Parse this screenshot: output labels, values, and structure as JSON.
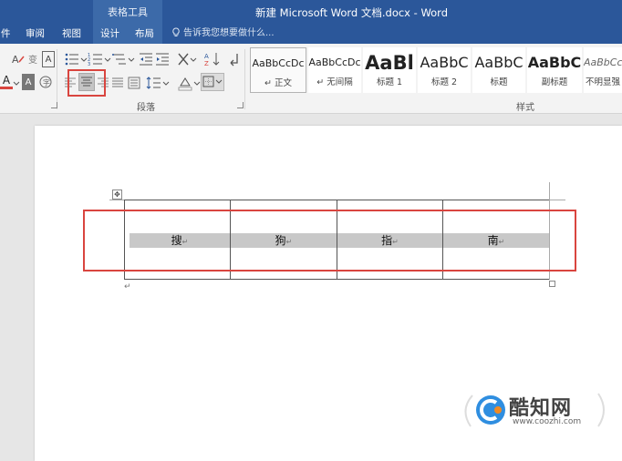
{
  "titlebar": {
    "context_tab": "表格工具",
    "doc_title": "新建 Microsoft Word 文档.docx - Word"
  },
  "tabs": [
    {
      "label": "件"
    },
    {
      "label": "审阅"
    },
    {
      "label": "视图"
    },
    {
      "label": "设计"
    },
    {
      "label": "布局"
    }
  ],
  "tell_me": "告诉我您想要做什么...",
  "ribbon": {
    "groups": {
      "paragraph": "段落",
      "styles": "样式"
    },
    "styles": [
      {
        "preview": "AaBbCcDc",
        "name": "正文"
      },
      {
        "preview": "AaBbCcDc",
        "name": "无间隔"
      },
      {
        "preview": "AaBl",
        "name": "标题 1"
      },
      {
        "preview": "AaBbC",
        "name": "标题 2"
      },
      {
        "preview": "AaBbC",
        "name": "标题"
      },
      {
        "preview": "AaBbC",
        "name": "副标题"
      },
      {
        "preview": "AaBbCcDc",
        "name": "不明显强"
      }
    ],
    "font_row": {
      "underline_a": "A",
      "highlight_a": "A",
      "char_shade": "A"
    }
  },
  "table": {
    "cells": [
      "搜",
      "狗",
      "指",
      "南"
    ],
    "cell_mark": "↵"
  },
  "paragraph_mark": "↵",
  "watermark": {
    "brand": "酷知网",
    "url": "www.coozhi.com"
  },
  "colors": {
    "title_blue": "#2b579a",
    "context_blue": "#3c6aa9",
    "highlight_red": "#d9453f",
    "cell_shade": "#c8c8c8"
  }
}
